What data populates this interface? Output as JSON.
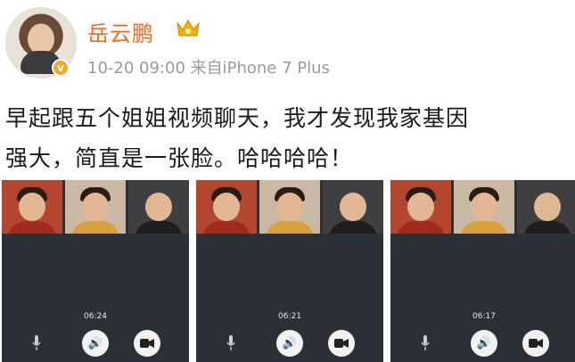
{
  "post": {
    "username": "岳云鹏",
    "meta": "10-20 09:00  来自iPhone 7 Plus",
    "text_line1": "早起跟五个姐姐视频聊天，我才发现我家基因",
    "text_line2": "强大，简直是一张脸。哈哈哈哈！",
    "verified_badge": "v"
  },
  "screenshots": [
    {
      "timer": "06:24"
    },
    {
      "timer": "06:21"
    },
    {
      "timer": "06:17"
    }
  ],
  "icons": {
    "mic": "microphone-icon",
    "speaker": "speaker-icon",
    "camera": "video-camera-icon"
  }
}
